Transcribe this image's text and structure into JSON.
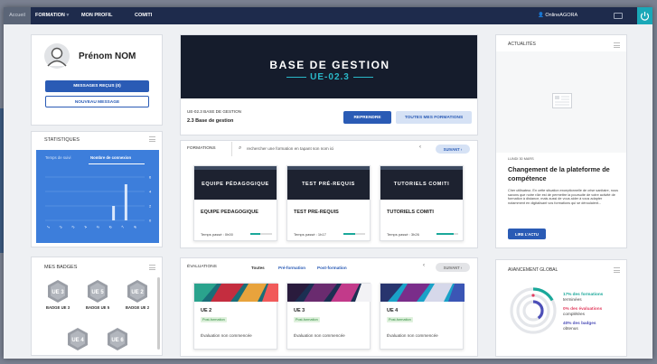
{
  "nav": {
    "home": "Accueil",
    "formation": "FORMATION",
    "profile": "MON PROFIL",
    "comiti": "COMITI",
    "user": "OnlineAGORA",
    "icons": [
      "chevron-down-icon",
      "user-icon",
      "mail-icon",
      "power-icon"
    ]
  },
  "profile": {
    "name": "Prénom NOM",
    "messages_button": "MESSAGES REÇUS (0)",
    "new_message_button": "NOUVEAU MESSAGE"
  },
  "stats": {
    "title": "STATISTIQUES",
    "tab_time": "Temps de suivi",
    "tab_connections": "Nombre de connexion"
  },
  "chart_data": {
    "type": "bar",
    "categories": [
      "1",
      "2",
      "3",
      "4",
      "5",
      "6",
      "7",
      "8"
    ],
    "values": [
      0,
      0,
      0,
      0,
      0,
      2,
      5,
      0
    ],
    "yticks": [
      "0",
      "2",
      "4",
      "6"
    ],
    "ylim": [
      0,
      6
    ],
    "xlabel": "",
    "ylabel": ""
  },
  "badges": {
    "title": "MES BADGES",
    "items": [
      {
        "code": "UE 3",
        "label": "BADGE UE 3"
      },
      {
        "code": "UE 5",
        "label": "BADGE UE 5"
      },
      {
        "code": "UE 2",
        "label": "BADGE UE 2"
      },
      {
        "code": "UE 4",
        "label": ""
      },
      {
        "code": "UE 6",
        "label": ""
      }
    ]
  },
  "hero": {
    "title": "BASE DE GESTION",
    "subtitle": "UE-02.3",
    "course_code": "UE-02.3 BASE DE GESTION",
    "course_name": "2.3 Base de gestion",
    "resume_button": "REPRENDRE",
    "all_button": "TOUTES MES FORMATIONS"
  },
  "formations": {
    "title": "FORMATIONS",
    "search_placeholder": "rechercher une formation en tapant son nom ici",
    "next": "SUIVANT",
    "courses": [
      {
        "banner": "EQUIPE PÉDAGOGIQUE",
        "name": "EQUIPE PEDAGOGIQUE",
        "time": "Temps passé : 0h00",
        "progress": 0.45
      },
      {
        "banner": "TEST PRÉ-REQUIS",
        "name": "TEST PRE-REQUIS",
        "time": "Temps passé : 1h17",
        "progress": 0.55
      },
      {
        "banner": "TUTORIELS COMITI",
        "name": "TUTORIELS COMITI",
        "time": "Temps passé : 3h26",
        "progress": 0.8
      }
    ]
  },
  "evaluations": {
    "title": "ÉVALUATIONS",
    "filter_all": "Toutes",
    "filter_pre": "Pré-formation",
    "filter_post": "Post-formation",
    "next": "SUIVANT",
    "items": [
      {
        "name": "UE 2",
        "tag": "Post-formation",
        "status": "Évaluation non commencée"
      },
      {
        "name": "UE 3",
        "tag": "Post-formation",
        "status": "Évaluation non commencée"
      },
      {
        "name": "UE 4",
        "tag": "Post-formation",
        "status": "Évaluation non commencée"
      }
    ]
  },
  "news": {
    "title": "ACTUALITÉS",
    "date": "LUNDI 30 MARS",
    "headline": "Changement de la plateforme de compétence",
    "body": "Cher utilisateur, En cette situation exceptionnelle de crise sanitaire, nous savons que notre rôle est de permettre la poursuite de votre activité de formation à distance, mais aussi de vous aider à vous adapter notamment en digitalisant vos formations qui se déroulaient...",
    "button": "LIRE L'ACTU"
  },
  "progress": {
    "title": "AVANCEMENT GLOBAL",
    "formations_pct": "17% des formations",
    "formations_label": "terminées",
    "formations_value": 0.17,
    "evaluations_pct": "0% des évaluations",
    "evaluations_label": "complétées",
    "evaluations_value": 0,
    "badges_pct": "40% des badges",
    "badges_label": "obtenus",
    "badges_value": 0.4,
    "colors": {
      "formations": "#1aa89a",
      "evaluations": "#e23d5f",
      "badges": "#4d4fb8"
    }
  }
}
